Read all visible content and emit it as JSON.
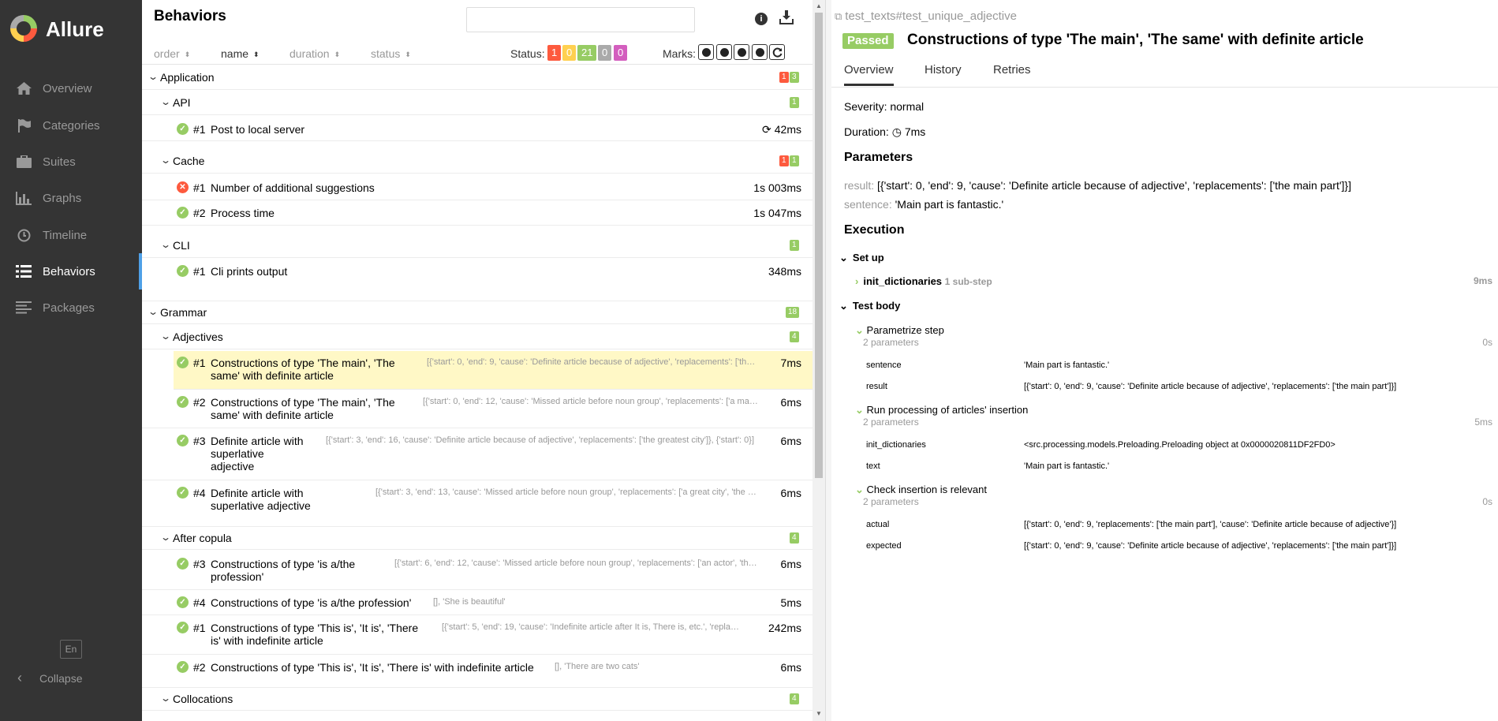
{
  "app": {
    "brand": "Allure"
  },
  "sidebar": {
    "items": [
      {
        "label": "Overview",
        "icon": "home-icon"
      },
      {
        "label": "Categories",
        "icon": "flag-icon"
      },
      {
        "label": "Suites",
        "icon": "briefcase-icon"
      },
      {
        "label": "Graphs",
        "icon": "bar-chart-icon"
      },
      {
        "label": "Timeline",
        "icon": "clock-icon"
      },
      {
        "label": "Behaviors",
        "icon": "list-icon",
        "active": true
      },
      {
        "label": "Packages",
        "icon": "align-left-icon"
      }
    ],
    "lang": "En",
    "collapse": "Collapse"
  },
  "behaviors": {
    "title": "Behaviors",
    "search_placeholder": "",
    "sort": {
      "order": "order",
      "name": "name",
      "duration": "duration",
      "status": "status"
    },
    "status_label": "Status:",
    "status_counts": [
      {
        "value": "1",
        "color": "#fd5a3e"
      },
      {
        "value": "0",
        "color": "#ffd050"
      },
      {
        "value": "21",
        "color": "#97cc64"
      },
      {
        "value": "0",
        "color": "#aaaaaa"
      },
      {
        "value": "0",
        "color": "#d35ebe"
      }
    ],
    "marks_label": "Marks:",
    "groups": {
      "application": {
        "name": "Application",
        "failed": "1",
        "passed": "3"
      },
      "api": {
        "name": "API",
        "passed": "1"
      },
      "cache": {
        "name": "Cache",
        "failed": "1",
        "passed": "1"
      },
      "cli": {
        "name": "CLI",
        "passed": "1"
      },
      "grammar": {
        "name": "Grammar",
        "passed": "18"
      },
      "adjectives": {
        "name": "Adjectives",
        "passed": "4"
      },
      "after_copula": {
        "name": "After copula",
        "passed": "4"
      },
      "collocations": {
        "name": "Collocations",
        "passed": "4"
      }
    },
    "tests": {
      "api1": {
        "num": "#1",
        "name": "Post to local server",
        "duration": "42ms"
      },
      "cache1": {
        "num": "#1",
        "name": "Number of additional suggestions",
        "duration": "1s 003ms"
      },
      "cache2": {
        "num": "#2",
        "name": "Process time",
        "duration": "1s 047ms"
      },
      "cli1": {
        "num": "#1",
        "name": "Cli prints output",
        "duration": "348ms"
      },
      "adj1": {
        "num": "#1",
        "name_l1": "Constructions of type 'The main', 'The",
        "name_l2": "same' with definite article",
        "params": "[{'start': 0, 'end': 9, 'cause': 'Definite article because of adjective', 'replacements': ['the main part']}]",
        "duration": "7ms"
      },
      "adj2": {
        "num": "#2",
        "name_l1": "Constructions of type 'The main', 'The",
        "name_l2": "same' with definite article",
        "params": "[{'start': 0, 'end': 12, 'cause': 'Missed article before noun group', 'replacements': ['a main part']}]",
        "duration": "6ms"
      },
      "adj3": {
        "num": "#3",
        "name_l1": "Definite article with",
        "name_l2": "superlative",
        "name_l3": "adjective",
        "params": "[{'start': 3, 'end': 16, 'cause': 'Definite article because of adjective', 'replacements': ['the greatest city']}, {'start': 0}]",
        "duration": "6ms"
      },
      "adj4": {
        "num": "#4",
        "name_l1": "Definite article with",
        "name_l2": "superlative adjective",
        "params": "[{'start': 3, 'end': 13, 'cause': 'Missed article before noun group', 'replacements': ['a great city', 'the great city']}]",
        "duration": "6ms"
      },
      "cop3": {
        "num": "#3",
        "name_l1": "Constructions of type 'is a/the",
        "name_l2": "profession'",
        "params": "[{'start': 6, 'end': 12, 'cause': 'Missed article before noun group', 'replacements': ['an actor', 'the actor']}]",
        "duration": "6ms"
      },
      "cop4": {
        "num": "#4",
        "name": "Constructions of type 'is a/the profession'",
        "params": "[], 'She is beautiful'",
        "duration": "5ms"
      },
      "cop1": {
        "num": "#1",
        "name_l1": "Constructions of type 'This is', 'It is', 'There",
        "name_l2": "is' with indefinite article",
        "params": "[{'start': 5, 'end': 19, 'cause': 'Indefinite article after It is, There is, etc.', 'replacements': ['a cat']}]",
        "duration": "242ms"
      },
      "cop2": {
        "num": "#2",
        "name": "Constructions of type 'This is', 'It is', 'There is' with indefinite article",
        "params": "[], 'There are two cats'",
        "duration": "6ms"
      }
    }
  },
  "detail": {
    "path": "test_texts#test_unique_adjective",
    "status": "Passed",
    "title": "Constructions of type 'The main', 'The same' with definite article",
    "tabs": [
      "Overview",
      "History",
      "Retries"
    ],
    "severity": "Severity: normal",
    "duration_label": "Duration:",
    "duration_value": "7ms",
    "parameters_heading": "Parameters",
    "params": [
      {
        "key": "result:",
        "value": "[{'start': 0, 'end': 9, 'cause': 'Definite article because of adjective', 'replacements': ['the main part']}]"
      },
      {
        "key": "sentence:",
        "value": "'Main part is fantastic.'"
      }
    ],
    "execution_heading": "Execution",
    "setup": {
      "label": "Set up",
      "step": "init_dictionaries",
      "substeps": "1 sub-step",
      "time": "9ms"
    },
    "body": {
      "label": "Test body",
      "steps": [
        {
          "name": "Parametrize step",
          "count": "2 parameters",
          "time": "0s",
          "params": [
            {
              "k": "sentence",
              "v": "'Main part is fantastic.'"
            },
            {
              "k": "result",
              "v": "[{'start': 0, 'end': 9, 'cause': 'Definite article because of adjective', 'replacements': ['the main part']}]"
            }
          ]
        },
        {
          "name": "Run processing of articles' insertion",
          "count": "2 parameters",
          "time": "5ms",
          "params": [
            {
              "k": "init_dictionaries",
              "v": "<src.processing.models.Preloading.Preloading object at 0x0000020811DF2FD0>"
            },
            {
              "k": "text",
              "v": "'Main part is fantastic.'"
            }
          ]
        },
        {
          "name": "Check insertion is relevant",
          "count": "2 parameters",
          "time": "0s",
          "params": [
            {
              "k": "actual",
              "v": "[{'start': 0, 'end': 9, 'replacements': ['the main part'], 'cause': 'Definite article because of adjective'}]"
            },
            {
              "k": "expected",
              "v": "[{'start': 0, 'end': 9, 'cause': 'Definite article because of adjective', 'replacements': ['the main part']}]"
            }
          ]
        }
      ]
    }
  }
}
